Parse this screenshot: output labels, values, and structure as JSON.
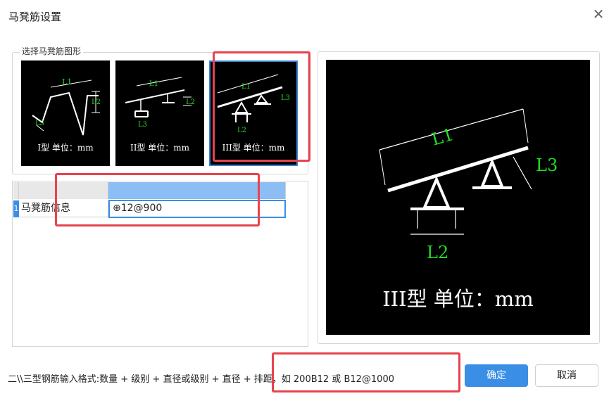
{
  "dialog": {
    "title": "马凳筋设置",
    "close_icon": "close-icon"
  },
  "shape_group": {
    "legend": "选择马凳筋图形",
    "options": [
      {
        "caption": "I型 单位：mm",
        "l1": "L1",
        "l2": "L2",
        "l3": "L3",
        "selected": false
      },
      {
        "caption": "II型 单位：mm",
        "l1": "L1",
        "l2": "L2",
        "l3": "L3",
        "selected": false
      },
      {
        "caption": "III型 单位：mm",
        "l1": "L1",
        "l2": "L2",
        "l3": "L3",
        "selected": true
      }
    ]
  },
  "table": {
    "rows": [
      {
        "num": "1",
        "label": "马凳筋信息",
        "value": "⊕12@900"
      }
    ]
  },
  "preview": {
    "caption": "III型 单位：mm",
    "l1": "L1",
    "l2": "L2",
    "l3": "L3"
  },
  "footer": {
    "hint": "二\\\\三型钢筋输入格式:数量 + 级别 + 直径或级别 + 直径 + 排距，如 200B12 或 B12@1000",
    "ok_label": "确定",
    "cancel_label": "取消"
  },
  "colors": {
    "accent": "#3a8ee6",
    "highlight": "#e8434d",
    "dimension_text": "#22dd22"
  }
}
